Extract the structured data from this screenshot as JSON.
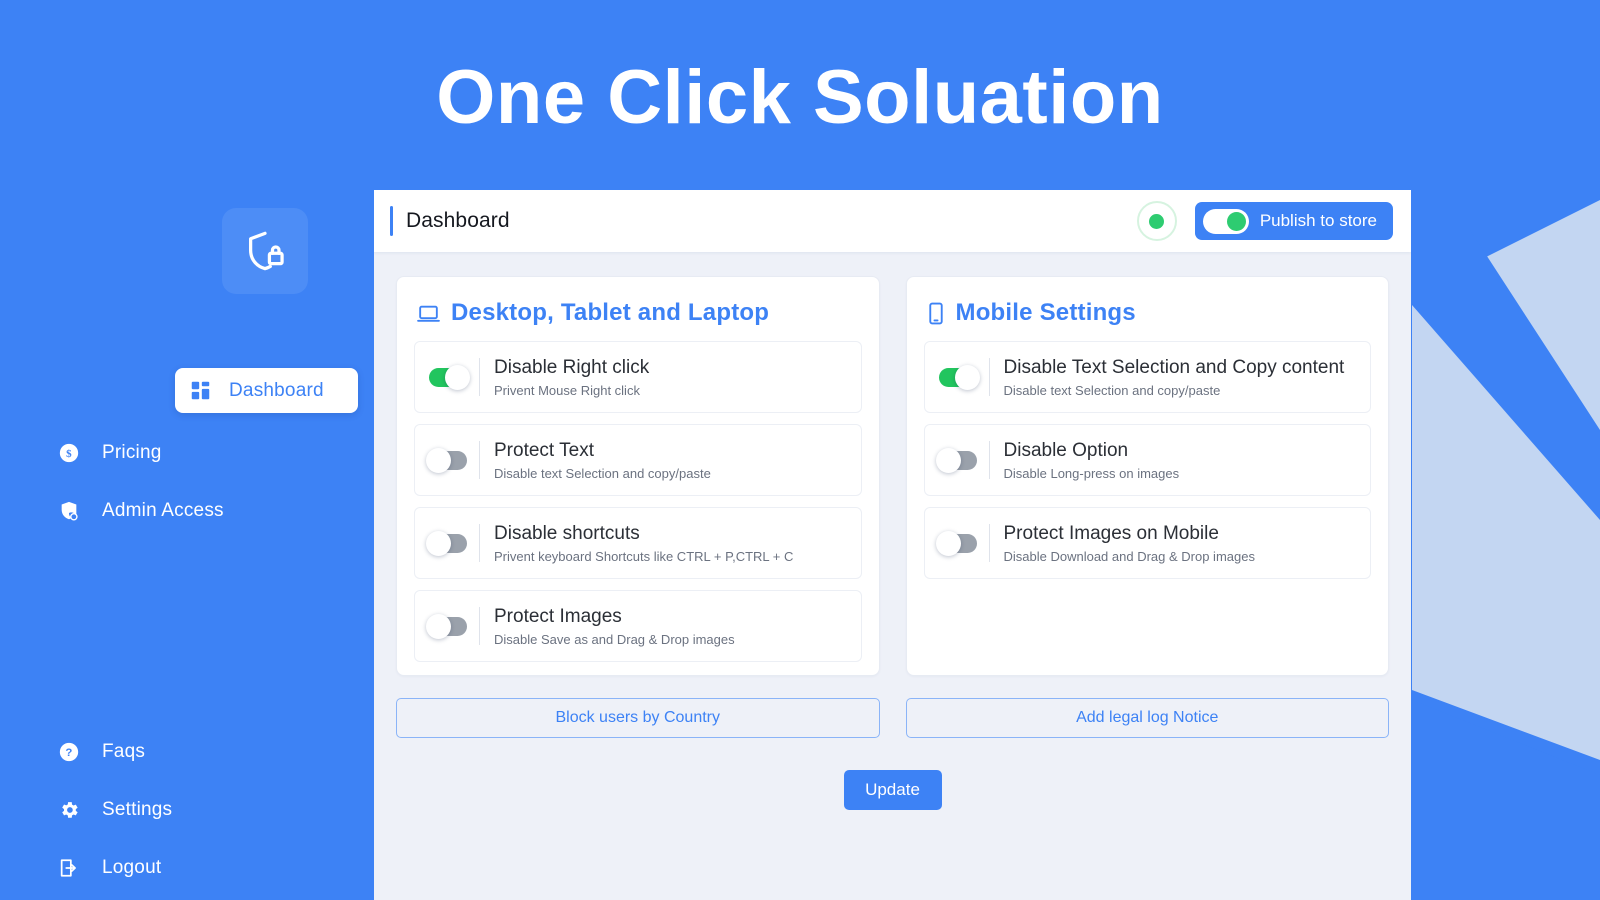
{
  "app": {
    "title": "One Click Soluation",
    "brand_blue": "#3d82f5",
    "accent_green": "#22c55e",
    "content_bg": "#eef1f8"
  },
  "sidebar": {
    "logo_icon": "shield-lock-icon",
    "top_items": [
      {
        "label": "Dashboard",
        "icon": "grid-dashboard-icon",
        "active": true
      },
      {
        "label": "Pricing",
        "icon": "dollar-circle-icon",
        "active": false
      },
      {
        "label": "Admin Access",
        "icon": "shield-user-icon",
        "active": false
      }
    ],
    "bottom_items": [
      {
        "label": "Faqs",
        "icon": "question-circle-icon",
        "active": false
      },
      {
        "label": "Settings",
        "icon": "gear-icon",
        "active": false
      },
      {
        "label": "Logout",
        "icon": "logout-arrow-icon",
        "active": false
      }
    ]
  },
  "topbar": {
    "title": "Dashboard",
    "status_dot_color": "#2ecc71",
    "publish_label": "Publish to store",
    "publish_enabled": true
  },
  "desktop_panel": {
    "icon": "laptop-icon",
    "title": "Desktop, Tablet and Laptop",
    "settings": [
      {
        "title": "Disable Right click",
        "subtitle": "Privent Mouse Right click",
        "enabled": true
      },
      {
        "title": "Protect Text",
        "subtitle": "Disable text Selection and copy/paste",
        "enabled": false
      },
      {
        "title": "Disable shortcuts",
        "subtitle": "Privent keyboard Shortcuts like CTRL + P,CTRL + C",
        "enabled": false
      },
      {
        "title": "Protect Images",
        "subtitle": "Disable Save as and Drag & Drop images",
        "enabled": false
      }
    ],
    "action_label": "Block users by Country"
  },
  "mobile_panel": {
    "icon": "mobile-phone-icon",
    "title": "Mobile Settings",
    "settings": [
      {
        "title": "Disable Text Selection and Copy content",
        "subtitle": "Disable text Selection and copy/paste",
        "enabled": true
      },
      {
        "title": "Disable Option",
        "subtitle": "Disable Long-press on images",
        "enabled": false
      },
      {
        "title": "Protect Images on Mobile",
        "subtitle": "Disable Download and Drag & Drop images",
        "enabled": false
      }
    ],
    "action_label": "Add legal log Notice"
  },
  "footer": {
    "update_label": "Update"
  }
}
